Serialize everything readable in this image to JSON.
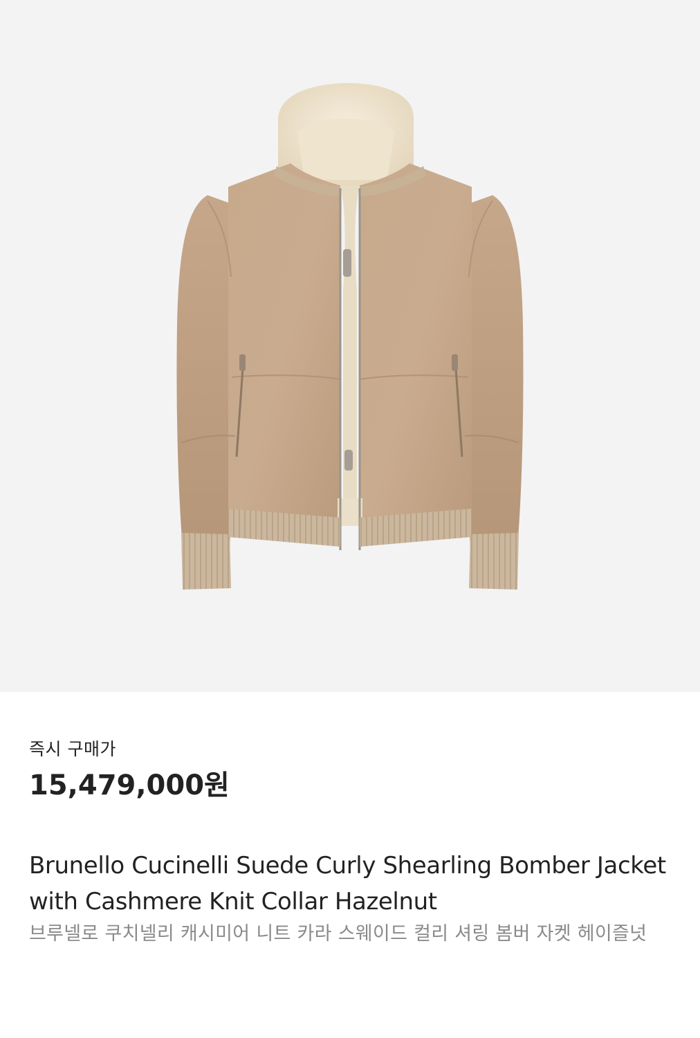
{
  "product": {
    "image_alt": "Brunello Cucinelli shearling bomber jacket",
    "price_label": "즉시 구매가",
    "price": "15,479,000원",
    "name_en": "Brunello Cucinelli Suede Curly Shearling Bomber Jacket with Cashmere Knit Collar Hazelnut",
    "name_ko": "브루넬로 쿠치넬리 캐시미어 니트 카라 스웨이드 컬리 셔링 봄버 자켓 헤이즐넛"
  },
  "colors": {
    "image_background": "#f3f3f4",
    "suede": "#c4a386",
    "shearling": "#efe6d3",
    "knit": "#c9b59c",
    "text_primary": "#222222",
    "text_secondary": "#8a8a8a"
  }
}
